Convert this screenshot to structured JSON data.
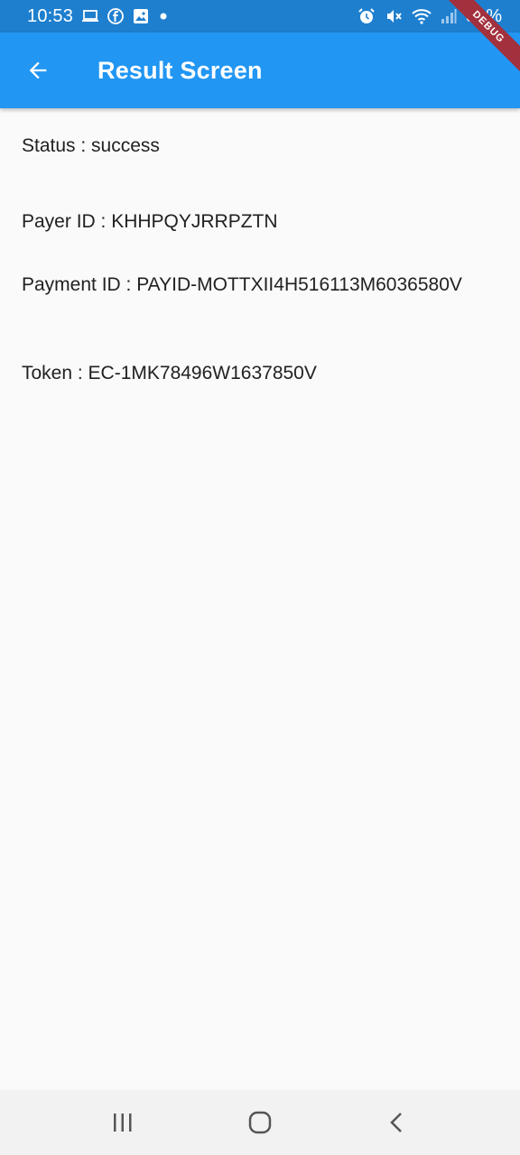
{
  "status_bar": {
    "time": "10:53",
    "battery": "39%",
    "icons_left": [
      "laptop-icon",
      "facebook-icon",
      "image-icon",
      "dot-icon"
    ],
    "icons_right": [
      "alarm-icon",
      "mute-icon",
      "wifi-icon",
      "signal-icon"
    ]
  },
  "app_bar": {
    "title": "Result Screen",
    "background": "#2196f3"
  },
  "debug_banner": "DEBUG",
  "result": {
    "status": "Status : success",
    "payer_id": "Payer ID : KHHPQYJRRPZTN",
    "payment_id": "Payment ID : PAYID-MOTTXII4H516113M6036580V",
    "token": "Token : EC-1MK78496W1637850V"
  },
  "nav_bar": {
    "icons": [
      "recent-apps-icon",
      "home-icon",
      "back-icon"
    ]
  }
}
